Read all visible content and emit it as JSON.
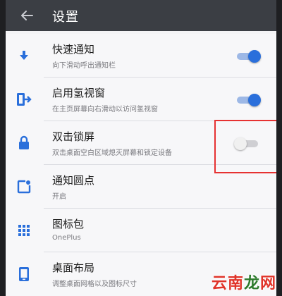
{
  "header": {
    "title": "设置"
  },
  "rows": [
    {
      "title": "快速通知",
      "subtitle": "向下滑动呼出通知栏",
      "icon": "arrow-down-icon",
      "toggle": "on"
    },
    {
      "title": "启用氢视窗",
      "subtitle": "在主页屏幕向右滑动以访问氢视窗",
      "icon": "exit-screen-icon",
      "toggle": "on"
    },
    {
      "title": "双击锁屏",
      "subtitle": "双击桌面空白区域熄灭屏幕和锁定设备",
      "icon": "lock-icon",
      "toggle": "off"
    },
    {
      "title": "通知圆点",
      "subtitle": "开启",
      "icon": "notification-dot-icon",
      "toggle": null
    },
    {
      "title": "图标包",
      "subtitle": "OnePlus",
      "icon": "grid-icon",
      "toggle": null
    },
    {
      "title": "桌面布局",
      "subtitle": "调整桌面网格以及图标尺寸",
      "icon": "phone-icon",
      "toggle": null
    }
  ],
  "watermark": {
    "part1": "云南",
    "part2": "龙",
    "part3": "网"
  },
  "colors": {
    "accent": "#2a6fdb",
    "highlight": "#e63232",
    "topbar": "#3b3e44"
  }
}
